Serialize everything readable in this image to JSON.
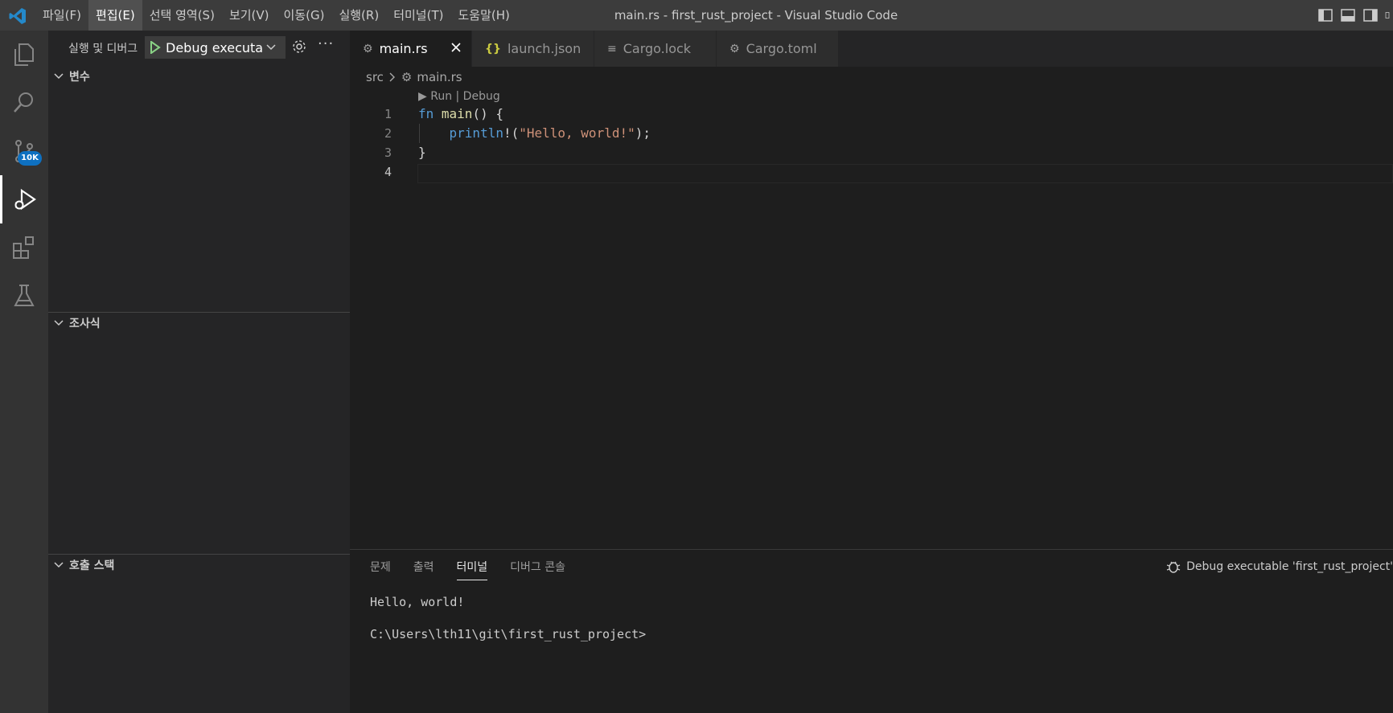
{
  "window": {
    "title": "main.rs - first_rust_project - Visual Studio Code"
  },
  "menu": [
    "파일(F)",
    "편집(E)",
    "선택 영역(S)",
    "보기(V)",
    "이동(G)",
    "실행(R)",
    "터미널(T)",
    "도움말(H)"
  ],
  "activity": {
    "scm_badge": "10K"
  },
  "sidebar": {
    "title": "실행 및 디버그",
    "debug_config": "Debug executable 'first_rust_project'",
    "sections": [
      "변수",
      "조사식",
      "호출 스택"
    ]
  },
  "tabs": [
    {
      "label": "main.rs",
      "icon": "rust-icon"
    },
    {
      "label": "launch.json",
      "icon": "json-icon"
    },
    {
      "label": "Cargo.lock",
      "icon": "lines-icon"
    },
    {
      "label": "Cargo.toml",
      "icon": "gear-icon"
    }
  ],
  "breadcrumb": {
    "folder": "src",
    "file": "main.rs"
  },
  "codelens": "▶ Run | Debug",
  "editor": {
    "line_numbers": [
      "1",
      "2",
      "3",
      "4"
    ],
    "code": {
      "l1_kw": "fn",
      "l1_name": "main",
      "l1_rest": "() {",
      "l2_indent": "    ",
      "l2_macro": "println",
      "l2_bang": "!(",
      "l2_str": "\"Hello, world!\"",
      "l2_end": ");",
      "l3": "}"
    }
  },
  "panel": {
    "tabs": [
      "문제",
      "출력",
      "터미널",
      "디버그 콘솔"
    ],
    "active_tab": "터미널",
    "session": "Debug executable 'first_rust_project'",
    "terminal_lines": [
      "Hello, world!",
      "C:\\Users\\lth11\\git\\first_rust_project>"
    ]
  },
  "colors": {
    "accent": "#0e70c0",
    "vscode_blue": "#2489ca"
  }
}
